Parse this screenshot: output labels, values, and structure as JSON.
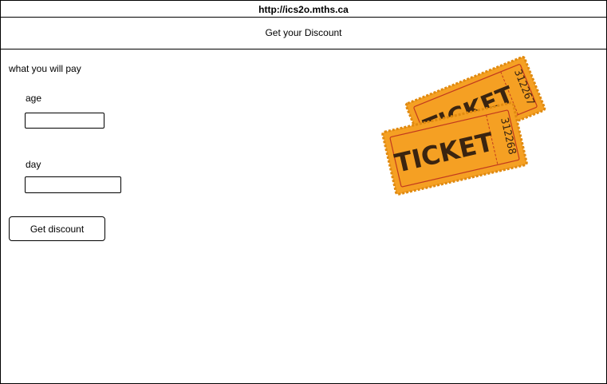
{
  "browser": {
    "url": "http://ics2o.mths.ca"
  },
  "header": {
    "title": "Get your Discount"
  },
  "form": {
    "result_label": "what you will pay",
    "age_label": "age",
    "age_value": "",
    "day_label": "day",
    "day_value": "",
    "submit_label": "Get discount"
  },
  "image": {
    "icon": "ticket-stub-image",
    "ticket_text": "TICKET",
    "back_ticket_number": "312267",
    "front_ticket_number": "312268",
    "ticket_color": "#f5a023",
    "ticket_edge_color": "#e08a10",
    "ticket_line_color": "#c23a1e",
    "ticket_text_color": "#3a2410"
  }
}
